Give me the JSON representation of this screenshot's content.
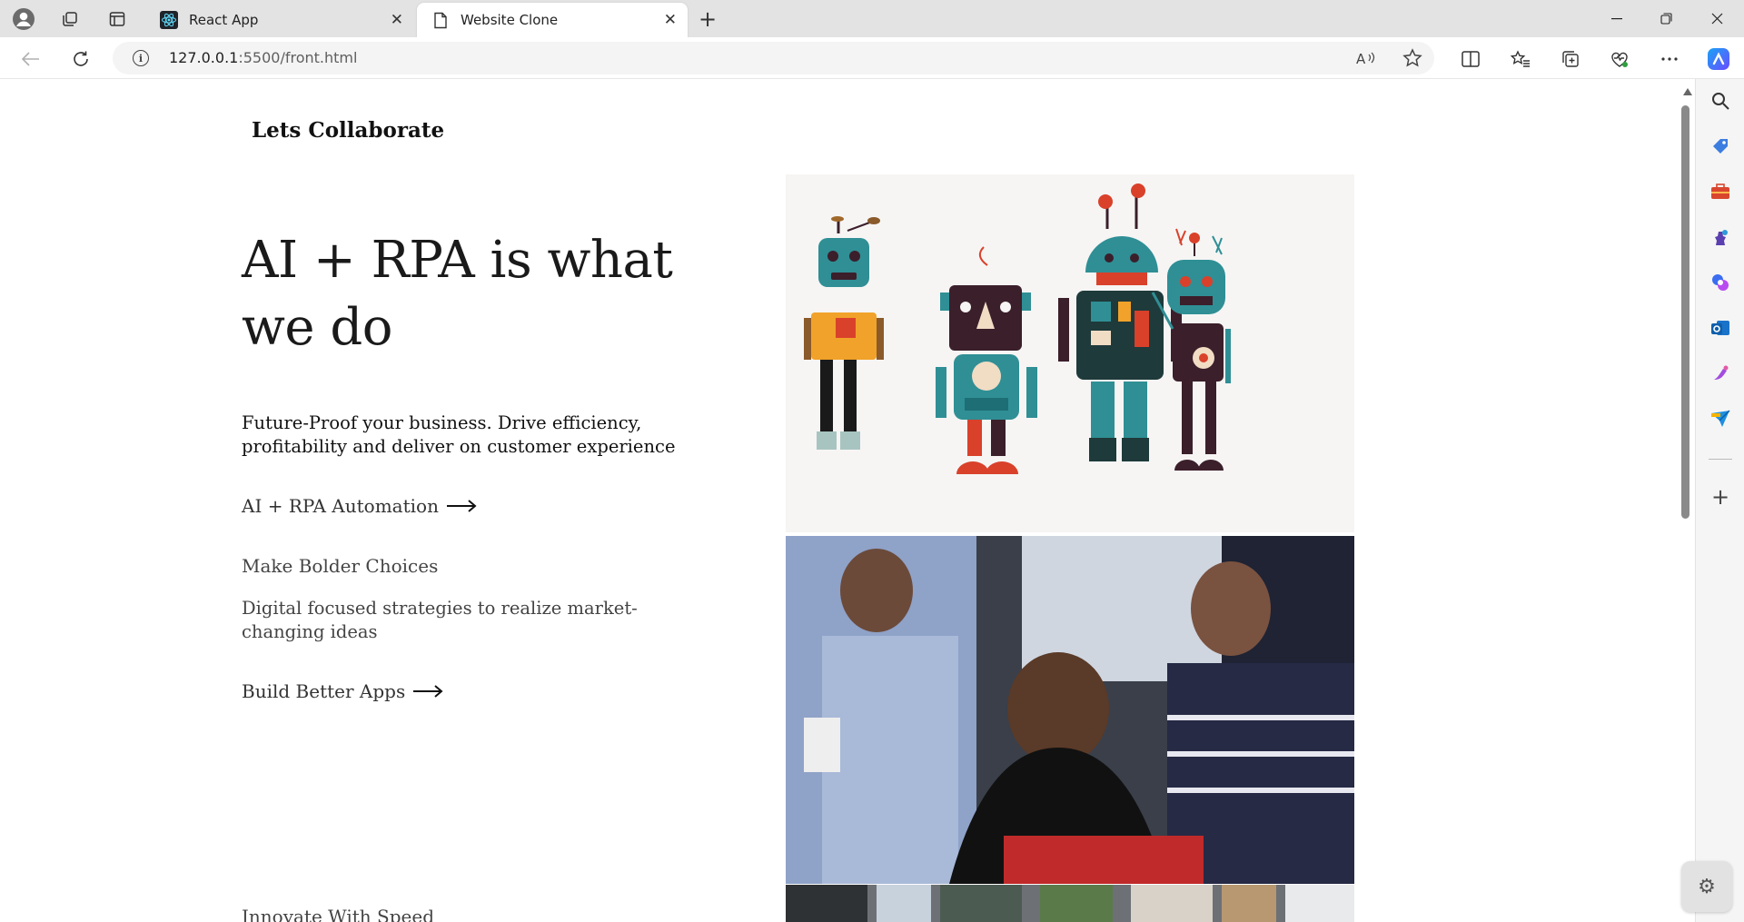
{
  "browser": {
    "tabs": [
      {
        "title": "React App",
        "active": false,
        "icon": "react-icon"
      },
      {
        "title": "Website Clone",
        "active": true,
        "icon": "document-icon"
      }
    ],
    "url_host": "127.0.0.1",
    "url_path": ":5500/front.html"
  },
  "page": {
    "brand": "Lets Collaborate",
    "hero_title": "AI + RPA is what we do",
    "lead": "Future-Proof your business. Drive efficiency, profitability and deliver on customer experience",
    "link_automation": "AI + RPA Automation",
    "heading_choices": "Make Bolder Choices",
    "desc_choices": "Digital focused strategies to realize market-changing ideas",
    "link_apps": "Build Better Apps",
    "heading_innovate": "Innovate With Speed"
  },
  "colors": {
    "accent": "#0b57d0",
    "robot_teal": "#2f8f95",
    "robot_orange": "#f1a22a",
    "robot_red": "#d9412b",
    "robot_dark": "#3b1f2b"
  }
}
